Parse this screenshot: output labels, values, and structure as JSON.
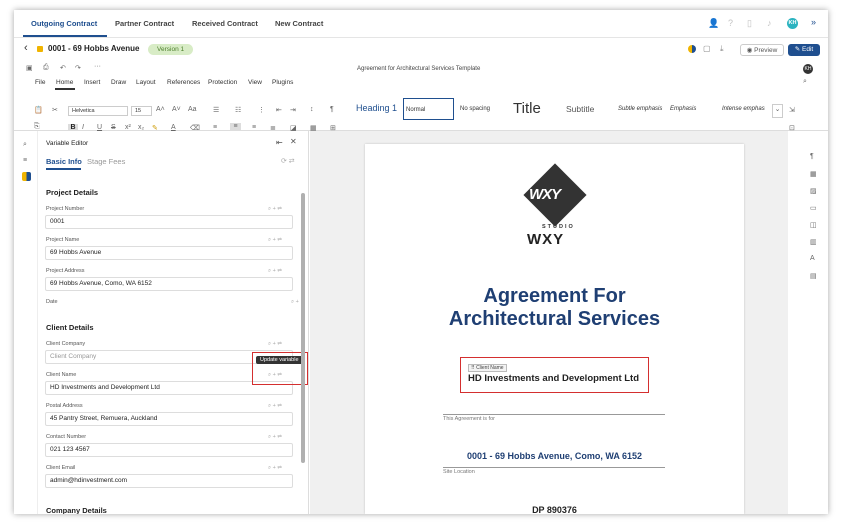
{
  "nav": {
    "tabs": [
      "Outgoing Contract",
      "Partner Contract",
      "Received Contract",
      "New Contract"
    ],
    "avatar": "KH"
  },
  "titlebar": {
    "back": "‹",
    "title": "0001 - 69 Hobbs Avenue",
    "version": "Version 1",
    "preview": "Preview",
    "edit": "Edit"
  },
  "editor": {
    "doc_title": "Agreement for Architectural Services Template",
    "avatar": "KH",
    "menu": [
      "File",
      "Home",
      "Insert",
      "Draw",
      "Layout",
      "References",
      "Protection",
      "View",
      "Plugins"
    ],
    "font": "Helvetica",
    "size": "15",
    "styles": [
      "Heading 1",
      "Normal",
      "No spacing",
      "Title",
      "Subtitle",
      "Subtle emphasis",
      "Emphasis",
      "Intense emphas"
    ]
  },
  "panel": {
    "title": "Variable Editor",
    "tabs": [
      "Basic Info",
      "Stage Fees"
    ],
    "sections": {
      "project": "Project Details",
      "client": "Client Details",
      "company": "Company Details"
    },
    "fields": {
      "project_number": {
        "label": "Project Number",
        "value": "0001"
      },
      "project_name": {
        "label": "Project Name",
        "value": "69 Hobbs Avenue"
      },
      "project_address": {
        "label": "Project Address",
        "value": "69 Hobbs Avenue, Como, WA 6152"
      },
      "date": {
        "label": "Date"
      },
      "client_company": {
        "label": "Client Company",
        "placeholder": "Client Company"
      },
      "client_name": {
        "label": "Client Name",
        "value": "HD Investments and Development Ltd"
      },
      "postal_address": {
        "label": "Postal Address",
        "value": "45 Pantry Street, Remuera, Auckland"
      },
      "contact_number": {
        "label": "Contact Number",
        "value": "021 123 4567"
      },
      "client_email": {
        "label": "Client Email",
        "value": "admin@hdinvestment.com"
      }
    },
    "tooltip": "Update variable"
  },
  "document": {
    "logo_top": "WXY",
    "logo_studio": "STUDIO",
    "logo_bottom": "WXY",
    "title_line1": "Agreement For",
    "title_line2": "Architectural Services",
    "var_tag": "Client Name",
    "client_value": "HD Investments and Development Ltd",
    "caption1": "This Agreement is for",
    "site": "0001 - 69 Hobbs Avenue, Como, WA 6152",
    "caption2": "Site Location",
    "dp": "DP 890376"
  },
  "colors": {
    "accent": "#1f4f8f",
    "highlight": "#d42f2f",
    "title_blue": "#1f3f73"
  }
}
